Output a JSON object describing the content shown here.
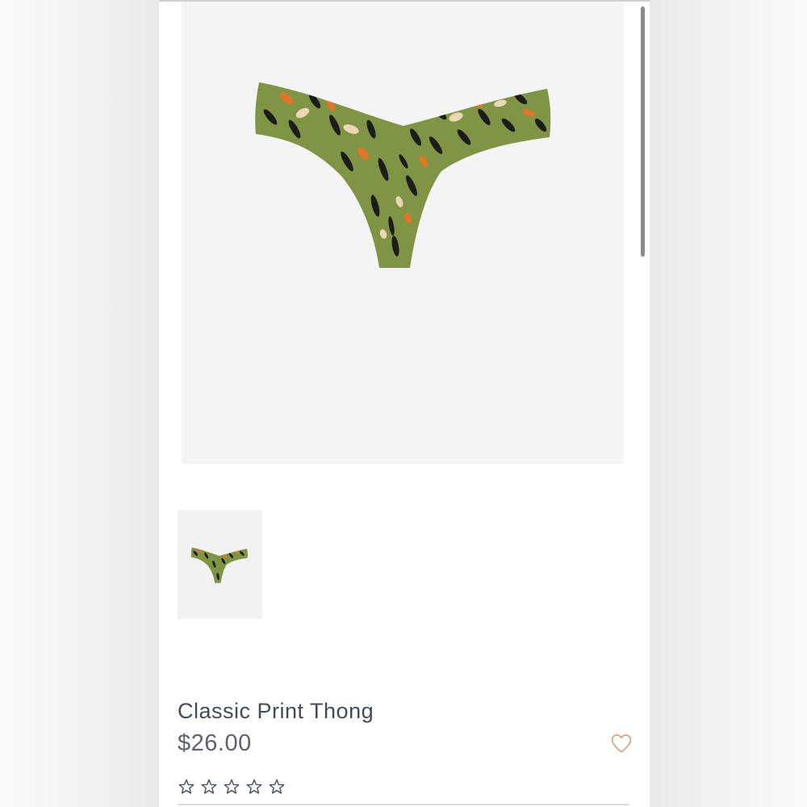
{
  "product": {
    "title": "Classic Print Thong",
    "price": "$26.00",
    "rating": {
      "filled": 0,
      "max": 5
    }
  },
  "icons": {
    "wishlist": "heart-outline-icon",
    "rating": "star-outline-icon"
  },
  "colors": {
    "print_base": "#7f9444",
    "print_spots": "#1c1c1a",
    "print_orange": "#e0762a",
    "print_cream": "#ecd7b4",
    "heart": "#d9a988",
    "title_text": "#414b5a"
  }
}
